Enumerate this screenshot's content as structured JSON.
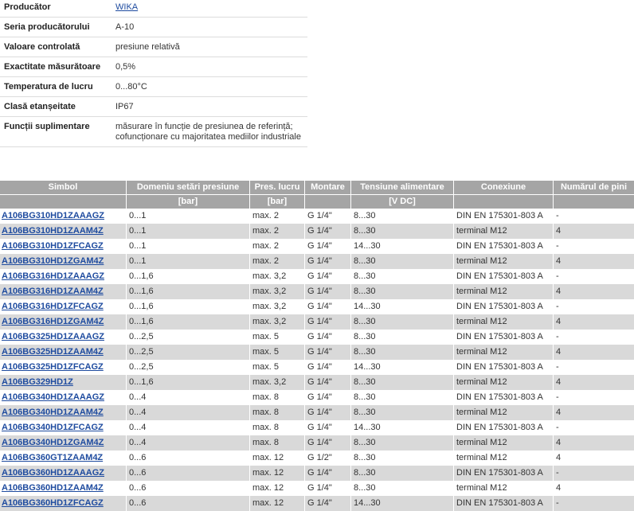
{
  "colors": {
    "link": "#1e4b9f",
    "header_bg": "#a5a5a5",
    "stripe_bg": "#d9d9d9"
  },
  "specs": [
    {
      "label": "Producător",
      "value": "WIKA"
    },
    {
      "label": "Seria producătorului",
      "value": "A-10"
    },
    {
      "label": "Valoare controlată",
      "value": "presiune relativă"
    },
    {
      "label": "Exactitate măsurătoare",
      "value": "0,5%"
    },
    {
      "label": "Temperatura de lucru",
      "value": "0...80°C"
    },
    {
      "label": "Clasă etanșeitate",
      "value": "IP67"
    },
    {
      "label": "Funcții suplimentare",
      "value": "măsurare în funcție de presiunea de referință; cofuncționare cu majoritatea mediilor industriale"
    }
  ],
  "table": {
    "headers": [
      "Simbol",
      "Domeniu setări presiune",
      "Pres. lucru",
      "Montare",
      "Tensiune alimentare",
      "Conexiune",
      "Numărul de pini"
    ],
    "units": [
      "",
      "[bar]",
      "[bar]",
      "",
      "[V DC]",
      "",
      ""
    ],
    "rows": [
      [
        "A106BG310HD1ZAAAGZ",
        "0...1",
        "max. 2",
        "G 1/4\"",
        "8...30",
        "DIN EN 175301-803 A",
        "-"
      ],
      [
        "A106BG310HD1ZAAM4Z",
        "0...1",
        "max. 2",
        "G 1/4\"",
        "8...30",
        "terminal M12",
        "4"
      ],
      [
        "A106BG310HD1ZFCAGZ",
        "0...1",
        "max. 2",
        "G 1/4\"",
        "14...30",
        "DIN EN 175301-803 A",
        "-"
      ],
      [
        "A106BG310HD1ZGAM4Z",
        "0...1",
        "max. 2",
        "G 1/4\"",
        "8...30",
        "terminal M12",
        "4"
      ],
      [
        "A106BG316HD1ZAAAGZ",
        "0...1,6",
        "max. 3,2",
        "G 1/4\"",
        "8...30",
        "DIN EN 175301-803 A",
        "-"
      ],
      [
        "A106BG316HD1ZAAM4Z",
        "0...1,6",
        "max. 3,2",
        "G 1/4\"",
        "8...30",
        "terminal M12",
        "4"
      ],
      [
        "A106BG316HD1ZFCAGZ",
        "0...1,6",
        "max. 3,2",
        "G 1/4\"",
        "14...30",
        "DIN EN 175301-803 A",
        "-"
      ],
      [
        "A106BG316HD1ZGAM4Z",
        "0...1,6",
        "max. 3,2",
        "G 1/4\"",
        "8...30",
        "terminal M12",
        "4"
      ],
      [
        "A106BG325HD1ZAAAGZ",
        "0...2,5",
        "max. 5",
        "G 1/4\"",
        "8...30",
        "DIN EN 175301-803 A",
        "-"
      ],
      [
        "A106BG325HD1ZAAM4Z",
        "0...2,5",
        "max. 5",
        "G 1/4\"",
        "8...30",
        "terminal M12",
        "4"
      ],
      [
        "A106BG325HD1ZFCAGZ",
        "0...2,5",
        "max. 5",
        "G 1/4\"",
        "14...30",
        "DIN EN 175301-803 A",
        "-"
      ],
      [
        "A106BG329HD1Z",
        "0...1,6",
        "max. 3,2",
        "G 1/4\"",
        "8...30",
        "terminal M12",
        "4"
      ],
      [
        "A106BG340HD1ZAAAGZ",
        "0...4",
        "max. 8",
        "G 1/4\"",
        "8...30",
        "DIN EN 175301-803 A",
        "-"
      ],
      [
        "A106BG340HD1ZAAM4Z",
        "0...4",
        "max. 8",
        "G 1/4\"",
        "8...30",
        "terminal M12",
        "4"
      ],
      [
        "A106BG340HD1ZFCAGZ",
        "0...4",
        "max. 8",
        "G 1/4\"",
        "14...30",
        "DIN EN 175301-803 A",
        "-"
      ],
      [
        "A106BG340HD1ZGAM4Z",
        "0...4",
        "max. 8",
        "G 1/4\"",
        "8...30",
        "terminal M12",
        "4"
      ],
      [
        "A106BG360GT1ZAAM4Z",
        "0...6",
        "max. 12",
        "G 1/2\"",
        "8...30",
        "terminal M12",
        "4"
      ],
      [
        "A106BG360HD1ZAAAGZ",
        "0...6",
        "max. 12",
        "G 1/4\"",
        "8...30",
        "DIN EN 175301-803 A",
        "-"
      ],
      [
        "A106BG360HD1ZAAM4Z",
        "0...6",
        "max. 12",
        "G 1/4\"",
        "8...30",
        "terminal M12",
        "4"
      ],
      [
        "A106BG360HD1ZFCAGZ",
        "0...6",
        "max. 12",
        "G 1/4\"",
        "14...30",
        "DIN EN 175301-803 A",
        "-"
      ]
    ]
  }
}
